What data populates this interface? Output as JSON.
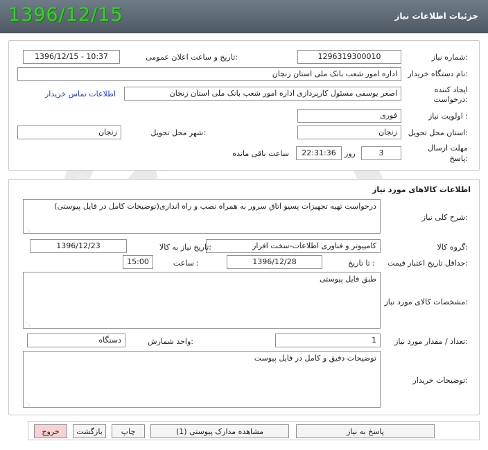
{
  "header": {
    "title": "جزئیات اطلاعات نیاز",
    "date": "1396/12/15"
  },
  "details": {
    "need_number_label": "شماره نیاز:",
    "need_number": "1296319300010",
    "announce_label": "تاریخ و ساعت اعلان عمومی:",
    "announce_value": "1396/12/15 - 10:37",
    "buyer_label": "نام دستگاه خریدار:",
    "buyer_value": "اداره امور شعب بانک ملی استان زنجان",
    "creator_label_1": "ایجاد کننده",
    "creator_label_2": "درخواست:",
    "creator_value": "اصغر یوسفی مسئول کارپردازی اداره امور شعب بانک ملی استان زنجان",
    "contact_link": "اطلاعات تماس خریدار",
    "priority_label": "اولویت نیاز :",
    "priority_value": "فوری",
    "province_label": "استان محل تحویل:",
    "province_value": "زنجان",
    "city_label": "شهر محل تحویل:",
    "city_value": "زنجان",
    "deadline_label_1": "مهلت ارسال",
    "deadline_label_2": "پاسخ:",
    "days_value": "3",
    "days_label": "روز و",
    "time_value": "22:31:36",
    "remaining_label": "ساعت باقی مانده"
  },
  "goods": {
    "section_title": "اطلاعات کالاهای مورد نیاز",
    "desc_label": "شرح کلی نیاز:",
    "desc_value": "درخواست تهیه تجهیزات پسیو اتاق سرور به همراه نصب و راه اندازی(توضیحات کامل در فایل پیوستی)",
    "group_label": "گروه کالا:",
    "group_value": "کامپیوتر و فناوری اطلاعات-سخت افزار",
    "need_date_label": "تاریخ نیاز به کالا:",
    "need_date_value": "1396/12/23",
    "validity_label": "حداقل تاریخ اعتبار قیمت:",
    "until_label": "تا تاریخ :",
    "validity_date": "1396/12/28",
    "hour_label": "ساعت :",
    "hour_value": "15:00",
    "specs_label": "مشخصات کالای مورد نیاز:",
    "specs_value": "طبق فایل پیوستی",
    "qty_label": "تعداد / مقدار مورد نیاز:",
    "qty_value": "1",
    "unit_label": "واحد شمارش:",
    "unit_value": "دستگاه",
    "buyer_notes_label": "توضیحات خریدار:",
    "buyer_notes_value": "توضیحات دقیق و کامل در فایل پیوست"
  },
  "buttons": {
    "reply": "پاسخ به نیاز",
    "attachments": "مشاهده مدارک پیوستی (1)",
    "print": "چاپ",
    "back": "بازگشت",
    "exit": "خروج"
  },
  "colors": {
    "header_bg": "#5e6975",
    "date_green": "#2fd61b",
    "link_blue": "#1b3fcc",
    "exit_pink": "#f7d2d2"
  }
}
